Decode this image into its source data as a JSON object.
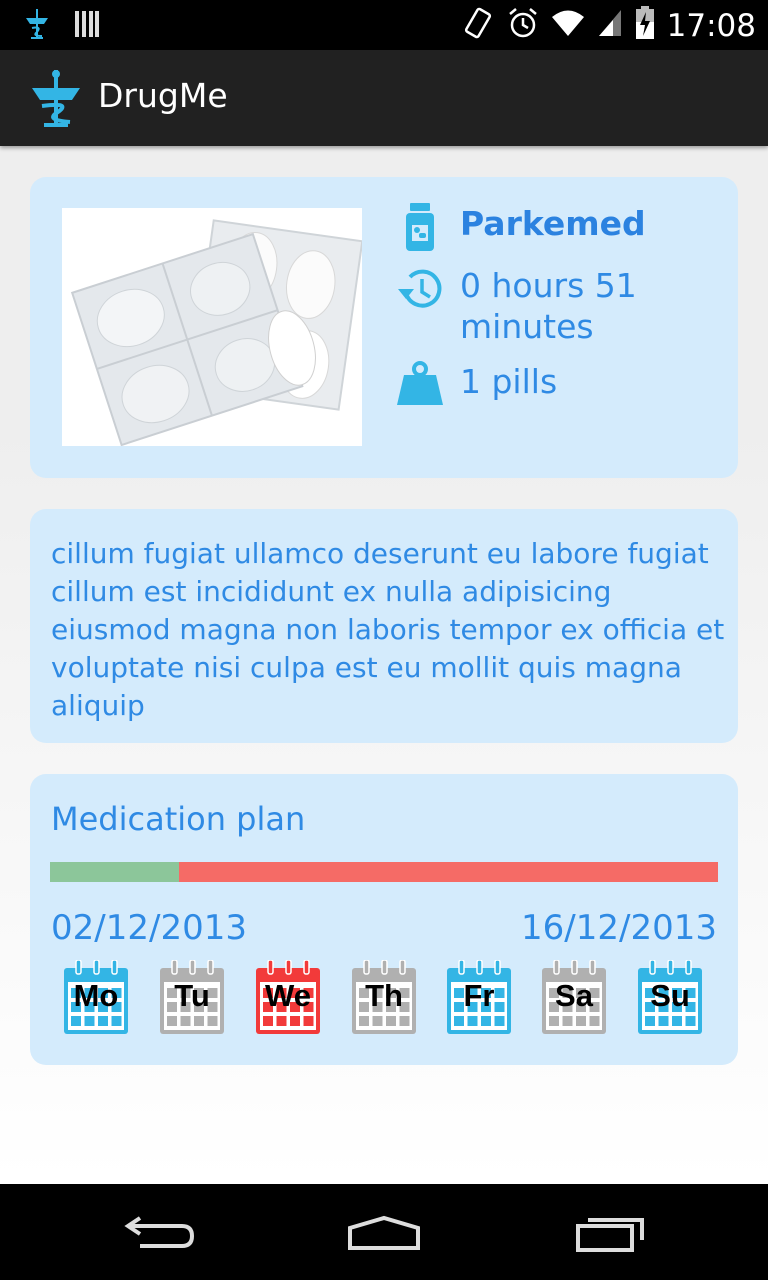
{
  "status_bar": {
    "time": "17:08",
    "icons": [
      "caduceus-icon",
      "storage-icon",
      "rotate-icon",
      "alarm-icon",
      "wifi-icon",
      "signal-icon",
      "battery-charging-icon"
    ]
  },
  "app": {
    "title": "DrugMe",
    "icon": "caduceus-icon"
  },
  "drug": {
    "name": "Parkemed",
    "interval": "0 hours 51 minutes",
    "dose": "1 pills",
    "image": "pill-blister-pack"
  },
  "description": "cillum fugiat ullamco deserunt eu labore fugiat cillum est incididunt ex nulla adipisicing eiusmod magna non laboris tempor ex officia et voluptate nisi culpa est eu mollit quis magna aliquip",
  "plan": {
    "title": "Medication plan",
    "progress_fraction": 0.193,
    "start_date": "02/12/2013",
    "end_date": "16/12/2013",
    "days": [
      {
        "label": "Mo",
        "status": "active"
      },
      {
        "label": "Tu",
        "status": "inactive"
      },
      {
        "label": "We",
        "status": "today"
      },
      {
        "label": "Th",
        "status": "inactive"
      },
      {
        "label": "Fr",
        "status": "active"
      },
      {
        "label": "Sa",
        "status": "inactive"
      },
      {
        "label": "Su",
        "status": "active"
      }
    ]
  },
  "colors": {
    "accent_text": "#2f8ae4",
    "card_bg": "#d4ebfc",
    "icon_blue": "#33b5e5",
    "progress_done": "#8cc69a",
    "progress_remaining": "#f56b66",
    "day_active": "#33b5e5",
    "day_inactive": "#b0b0b0",
    "day_today": "#f23a3a"
  },
  "nav": {
    "back": "back-icon",
    "home": "home-icon",
    "recents": "recents-icon"
  }
}
